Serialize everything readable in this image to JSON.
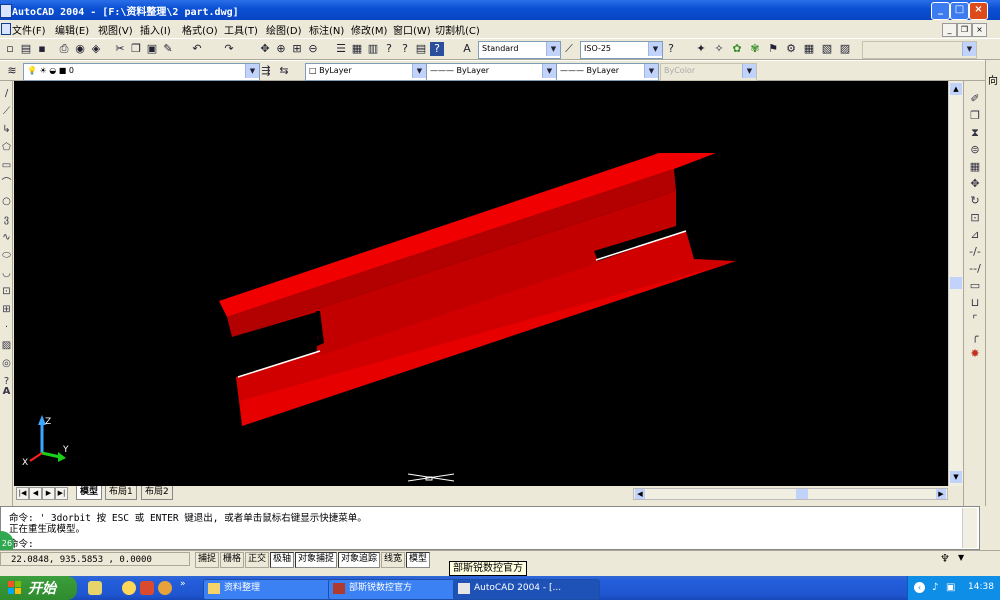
{
  "window": {
    "title": "AutoCAD 2004 - [F:\\资料整理\\2 part.dwg]",
    "minimize_label": "_",
    "maximize_label": "□",
    "close_label": "×"
  },
  "menu": [
    "文件(F)",
    "编辑(E)",
    "视图(V)",
    "插入(I)",
    "格式(O)",
    "工具(T)",
    "绘图(D)",
    "标注(N)",
    "修改(M)",
    "窗口(W)",
    "切割机(C)"
  ],
  "styles": {
    "text_style": "Standard",
    "dim_style": "ISO-25"
  },
  "layers": {
    "current_layer": "0",
    "color": "ByLayer",
    "linetype": "ByLayer",
    "lineweight": "ByLayer",
    "plot_style": "ByColor"
  },
  "layout_tabs": [
    "模型",
    "布局1",
    "布局2"
  ],
  "ucs": {
    "z_label": "Z",
    "y_label": "Y",
    "x_label": "X"
  },
  "command": {
    "history": [
      "命令: '_3dorbit 按 ESC 或 ENTER 键退出, 或者单击鼠标右键显示快捷菜单。",
      "正在重生成模型。"
    ],
    "prompt": "命令:"
  },
  "status": {
    "coordinates": "22.0848, 935.5853 , 0.0000",
    "toggles": [
      "捕捉",
      "栅格",
      "正交",
      "极轴",
      "对象捕捉",
      "对象追踪",
      "线宽",
      "模型"
    ]
  },
  "tooltip": "部斯锐数控官方",
  "taskbar": {
    "start_label": "开始",
    "tasks": [
      "资料整理",
      "部斯锐数控官方",
      "AutoCAD 2004 - [..."
    ],
    "clock": "14:38",
    "badge": "26"
  },
  "right_edge_char": "向",
  "colors": {
    "part_red": "#e00000",
    "viewport_bg": "#000000",
    "title_blue": "#0a4fd3"
  }
}
